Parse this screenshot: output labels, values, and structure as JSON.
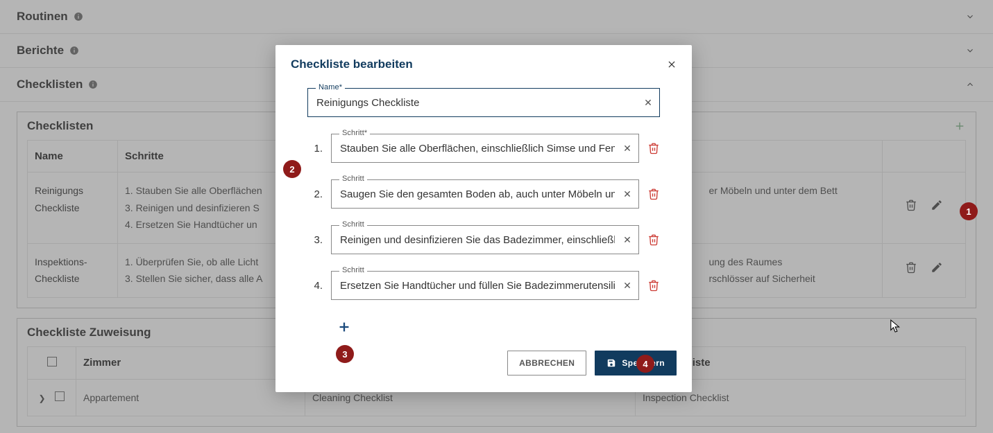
{
  "accordions": {
    "routines_label": "Routinen",
    "reports_label": "Berichte",
    "checklists_label": "Checklisten"
  },
  "panel_checklists": {
    "title": "Checklisten",
    "columns": {
      "name": "Name",
      "steps": "Schritte"
    },
    "rows": [
      {
        "name": "Reinigungs Checkliste",
        "step1": "1. Stauben Sie alle Oberflächen",
        "step3": "3. Reinigen und desinfizieren S",
        "step4": "4. Ersetzen Sie Handtücher un",
        "right_top": "er Möbeln und unter dem Bett"
      },
      {
        "name": "Inspektions-Checkliste",
        "step1": "1. Überprüfen Sie, ob alle Licht",
        "step3": "3. Stellen Sie sicher, dass alle A",
        "right_a": "ung des Raumes",
        "right_b": "rschlösser auf Sicherheit"
      }
    ]
  },
  "panel_assign": {
    "title": "Checkliste Zuweisung",
    "columns": {
      "room": "Zimmer",
      "col2": "",
      "col3": "ns-Checkliste"
    },
    "row": {
      "room": "Appartement",
      "c2": "Cleaning Checklist",
      "c3": "Inspection Checklist"
    }
  },
  "dialog": {
    "title": "Checkliste bearbeiten",
    "name_label": "Name*",
    "name_value": "Reinigungs Checkliste",
    "step_label_required": "Schritt*",
    "step_label": "Schritt",
    "steps": {
      "s1": "Stauben Sie alle Oberflächen, einschließlich Simse und Fenster",
      "s2": "Saugen Sie den gesamten Boden ab, auch unter Möbeln und un",
      "s3": "Reinigen und desinfizieren Sie das Badezimmer, einschließlich",
      "s4": "Ersetzen Sie Handtücher und füllen Sie Badezimmerutensilien a"
    },
    "step_nums": {
      "n1": "1.",
      "n2": "2.",
      "n3": "3.",
      "n4": "4."
    },
    "btn_cancel": "ABBRECHEN",
    "btn_save": "Speichern"
  },
  "badges": {
    "b1": "1",
    "b2": "2",
    "b3": "3",
    "b4": "4"
  }
}
